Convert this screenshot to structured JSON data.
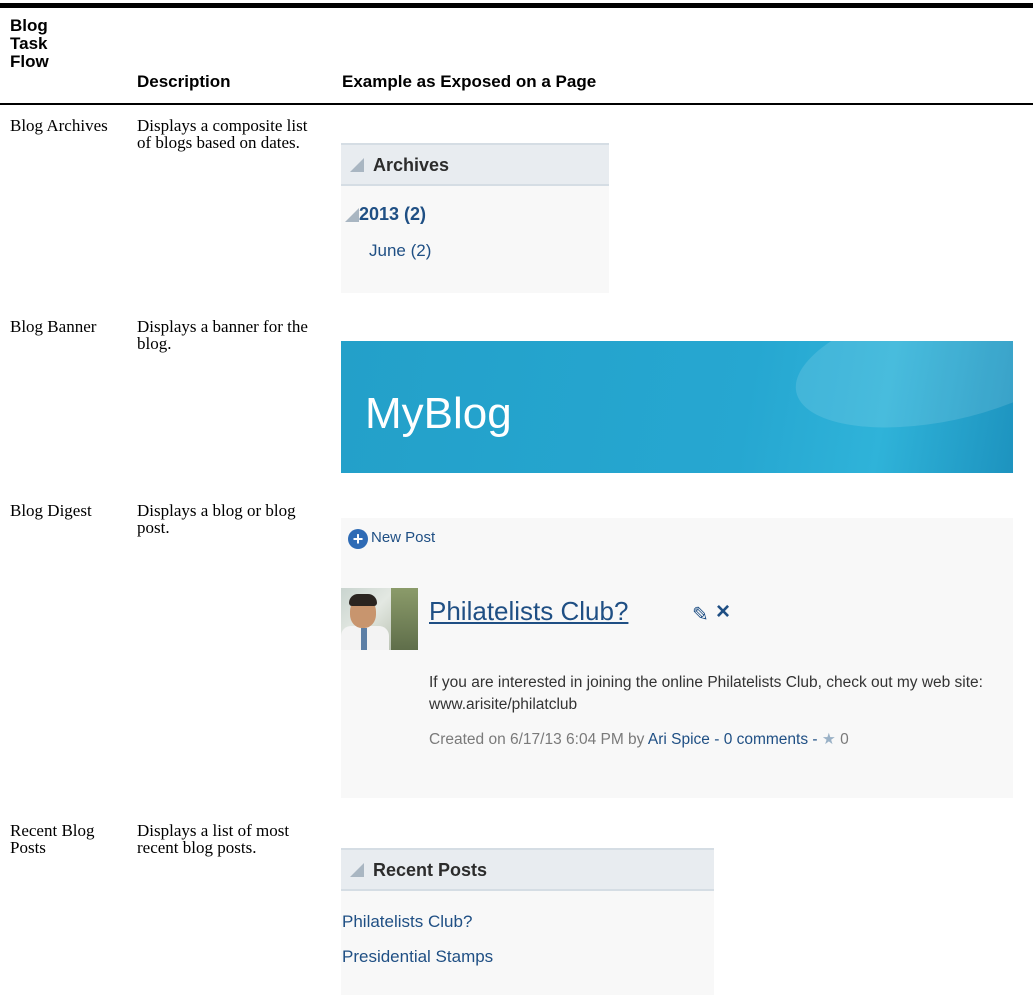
{
  "table": {
    "headers": {
      "flow": "Blog Task Flow",
      "description": "Description",
      "example": "Example as Exposed on a Page"
    },
    "rows": [
      {
        "flow": "Blog Archives",
        "description": "Displays a composite list of blogs based on dates."
      },
      {
        "flow": "Blog Banner",
        "description": "Displays a banner for the blog."
      },
      {
        "flow": "Blog Digest",
        "description": "Displays a blog or blog post."
      },
      {
        "flow": "Recent Blog Posts",
        "description": "Displays a list of most recent blog posts."
      }
    ]
  },
  "archives": {
    "title": "Archives",
    "year": "2013 (2)",
    "month": "June (2)"
  },
  "banner": {
    "title": "MyBlog"
  },
  "digest": {
    "new_post": "New Post",
    "post_title": "Philatelists Club?",
    "body": "If you are interested in joining the online Philatelists Club, check out my web site: www.arisite/philatclub",
    "created_prefix": "Created on 6/17/13 6:04 PM by",
    "author": "Ari Spice",
    "sep1": " - ",
    "comments": "0 comments",
    "sep2": " - ",
    "rating": "0",
    "icons": [
      "plus-circle-icon",
      "pencil-icon",
      "close-icon",
      "star-icon"
    ]
  },
  "recent": {
    "title": "Recent Posts",
    "items": [
      "Philatelists Club?",
      "Presidential Stamps"
    ]
  }
}
